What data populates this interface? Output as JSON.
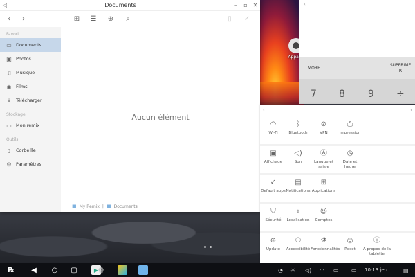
{
  "file_manager": {
    "title": "Documents",
    "sidebar": {
      "favorites_label": "Favori",
      "storage_label": "Stockage",
      "tools_label": "Outils",
      "items": [
        {
          "label": "Documents",
          "icon": "folder-icon"
        },
        {
          "label": "Photos",
          "icon": "image-icon"
        },
        {
          "label": "Musique",
          "icon": "music-icon"
        },
        {
          "label": "Films",
          "icon": "film-icon"
        },
        {
          "label": "Télécharger",
          "icon": "download-icon"
        },
        {
          "label": "Mon remix",
          "icon": "drive-icon"
        },
        {
          "label": "Corbeille",
          "icon": "trash-icon"
        },
        {
          "label": "Paramètres",
          "icon": "settings-icon"
        }
      ]
    },
    "empty_text": "Aucun élément",
    "path": [
      "My Remix",
      "Documents"
    ]
  },
  "desktop_icon": {
    "label": "Apparei"
  },
  "calculator": {
    "more_label": "MORE",
    "delete_label": "SUPPRIME R",
    "keys": [
      "7",
      "8",
      "9",
      "÷"
    ]
  },
  "settings": {
    "items": [
      {
        "label": "Wi-Fi",
        "icon": "wifi-icon"
      },
      {
        "label": "Bluetooth",
        "icon": "bluetooth-icon"
      },
      {
        "label": "VPN",
        "icon": "vpn-icon"
      },
      {
        "label": "Impression",
        "icon": "printer-icon"
      },
      {
        "label": "Affichage",
        "icon": "display-icon"
      },
      {
        "label": "Son",
        "icon": "volume-icon"
      },
      {
        "label": "Langue et saisie",
        "icon": "language-icon"
      },
      {
        "label": "Date et heure",
        "icon": "clock-icon"
      },
      {
        "label": "Default apps",
        "icon": "check-circle-icon"
      },
      {
        "label": "Notifications",
        "icon": "notification-icon"
      },
      {
        "label": "Applications",
        "icon": "apps-grid-icon"
      },
      {
        "label": "Sécurité",
        "icon": "shield-icon"
      },
      {
        "label": "Localisation",
        "icon": "location-icon"
      },
      {
        "label": "Comptes",
        "icon": "account-icon"
      },
      {
        "label": "Update",
        "icon": "update-icon"
      },
      {
        "label": "Accessibilité",
        "icon": "accessibility-icon"
      },
      {
        "label": "Fonctionnalités",
        "icon": "flask-icon"
      },
      {
        "label": "Reset",
        "icon": "reset-icon"
      },
      {
        "label": "A propos de la tablette",
        "icon": "info-icon"
      }
    ]
  },
  "taskbar": {
    "clock": "10:13 jeu."
  }
}
